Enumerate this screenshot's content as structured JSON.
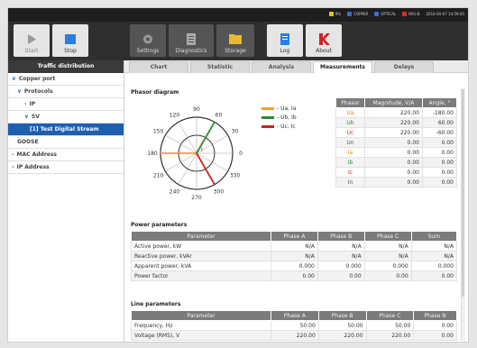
{
  "statusbar": {
    "items": [
      {
        "label": "9%",
        "color": "#e8c020",
        "icon": "battery-icon"
      },
      {
        "label": "COPPER",
        "color": "#3a6fd0",
        "icon": "copper-port-icon"
      },
      {
        "label": "OPTICAL",
        "color": "#3a6fd0",
        "icon": "optical-port-icon"
      },
      {
        "label": "IRIG-B",
        "color": "#d03030",
        "icon": "irig-b-icon"
      },
      {
        "label": "2014-04-07 14:59:45",
        "color": "",
        "icon": ""
      }
    ]
  },
  "toolbar": {
    "start": "Start",
    "stop": "Stop",
    "settings": "Settings",
    "diagnostics": "Diagnostics",
    "storage": "Storage",
    "log": "Log",
    "about": "About"
  },
  "sidebar": {
    "header": "Traffic distribution",
    "items": [
      {
        "label": "Copper port",
        "chev": "∨"
      },
      {
        "label": "Protocols",
        "chev": "∨"
      },
      {
        "label": "IP",
        "chev": "›"
      },
      {
        "label": "SV",
        "chev": "∨"
      },
      {
        "label": "[1] Test Digital Stream",
        "chev": ""
      },
      {
        "label": "GOOSE",
        "chev": ""
      },
      {
        "label": "MAC Address",
        "chev": "›"
      },
      {
        "label": "IP Address",
        "chev": "›"
      }
    ]
  },
  "tabs": [
    "Chart",
    "Statistic",
    "Analysis",
    "Measurements",
    "Delays"
  ],
  "phasor": {
    "title": "Phasor diagram",
    "angle_labels": [
      "90",
      "60",
      "30",
      "0",
      "330",
      "300",
      "270",
      "240",
      "210",
      "180",
      "150",
      "120"
    ],
    "legend": [
      {
        "label": "- Ua, Ia",
        "color": "#f0a030"
      },
      {
        "label": "- Ub, Ib",
        "color": "#2f8a2f"
      },
      {
        "label": "- Uc, Ic",
        "color": "#d02020"
      }
    ],
    "table_headers": [
      "Phasor",
      "Magnitude, V/A",
      "Angle, °"
    ],
    "rows": [
      {
        "name": "Ua",
        "color": "#e08a10",
        "mag": "220.00",
        "angle": "-180.00"
      },
      {
        "name": "Ub",
        "color": "#2f8a2f",
        "mag": "220.00",
        "angle": "60.00"
      },
      {
        "name": "Uc",
        "color": "#d02020",
        "mag": "220.00",
        "angle": "-60.00"
      },
      {
        "name": "Un",
        "color": "#555555",
        "mag": "0.00",
        "angle": "0.00"
      },
      {
        "name": "Ia",
        "color": "#e08a10",
        "mag": "0.00",
        "angle": "0.00"
      },
      {
        "name": "Ib",
        "color": "#2f8a2f",
        "mag": "0.00",
        "angle": "0.00"
      },
      {
        "name": "Ic",
        "color": "#d02020",
        "mag": "0.00",
        "angle": "0.00"
      },
      {
        "name": "In",
        "color": "#555555",
        "mag": "0.00",
        "angle": "0.00"
      }
    ]
  },
  "power": {
    "title": "Power parameters",
    "headers": [
      "Parameter",
      "Phase A",
      "Phase B",
      "Phase C",
      "Sum"
    ],
    "rows": [
      [
        "Active power, kW",
        "N/A",
        "N/A",
        "N/A",
        "N/A"
      ],
      [
        "Reactive power, kVAr",
        "N/A",
        "N/A",
        "N/A",
        "N/A"
      ],
      [
        "Apparent power, kVA",
        "0.000",
        "0.000",
        "0.000",
        "0.000"
      ],
      [
        "Power factor",
        "0.00",
        "0.00",
        "0.00",
        "0.00"
      ]
    ]
  },
  "line": {
    "title": "Line parameters",
    "headers": [
      "Parameter",
      "Phase A",
      "Phase B",
      "Phase C",
      "Phase N"
    ],
    "rows": [
      [
        "Frequency, Hz",
        "50.00",
        "50.00",
        "50.00",
        "0.00"
      ],
      [
        "Voltage (RMS), V",
        "220.00",
        "220.00",
        "220.00",
        "0.00"
      ]
    ]
  }
}
